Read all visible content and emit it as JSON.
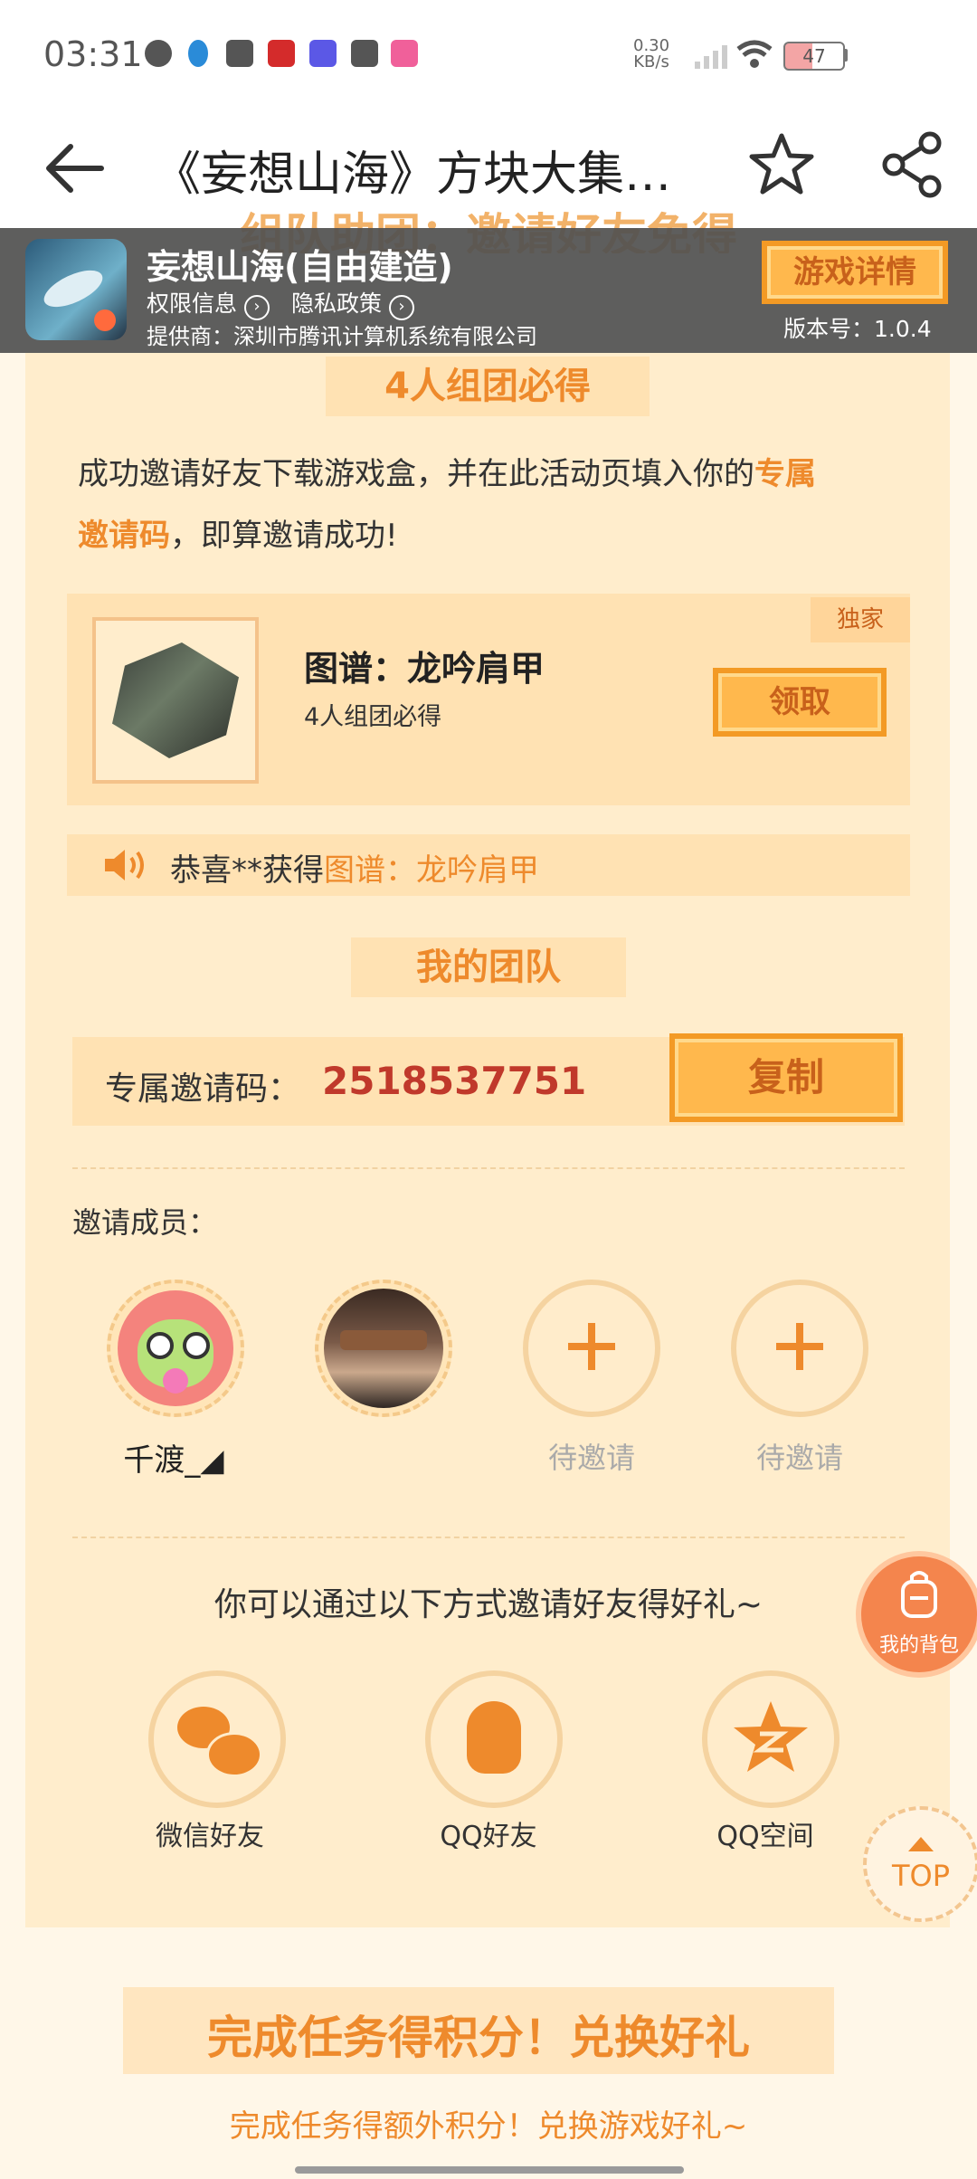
{
  "status_bar": {
    "time": "03:31",
    "net_speed_value": "0.30",
    "net_speed_unit": "KB/s",
    "battery": "47",
    "app_icons": [
      "play-icon",
      "qq-icon",
      "message-icon",
      "qidian-icon",
      "canva-icon",
      "video-icon",
      "app-icon"
    ]
  },
  "nav": {
    "title": "《妄想山海》方块大集…"
  },
  "game_bar": {
    "name": "妄想山海(自由建造)",
    "permission_label": "权限信息",
    "privacy_label": "隐私政策",
    "provider": "提供商：深圳市腾讯计算机系统有限公司",
    "detail_button": "游戏详情",
    "version": "版本号：1.0.4"
  },
  "invite": {
    "hidden_heading": "组队助团：邀请好友免得",
    "section_tag": "4人组团必得",
    "desc_part1": "成功邀请好友下载游戏盒，并在此活动页填入你的",
    "desc_highlight1": "专属",
    "desc_highlight2": "邀请码",
    "desc_part2": "，即算邀请成功!",
    "reward": {
      "badge": "独家",
      "title": "图谱：龙吟肩甲",
      "subtitle": "4人组团必得",
      "claim_button": "领取"
    },
    "ticker": {
      "prefix": "恭喜**获得",
      "item": "图谱：龙吟肩甲"
    },
    "team_tag": "我的团队",
    "code_label": "专属邀请码：",
    "code_value": "2518537751",
    "copy_button": "复制",
    "members_label": "邀请成员：",
    "members": [
      {
        "name": "千渡_◢",
        "avatar": "candy-avatar"
      },
      {
        "name": "",
        "avatar": "portrait-avatar"
      },
      {
        "name": "待邀请",
        "avatar": "plus-icon"
      },
      {
        "name": "待邀请",
        "avatar": "plus-icon"
      }
    ],
    "share_prompt": "你可以通过以下方式邀请好友得好礼~",
    "share": [
      {
        "label": "微信好友",
        "icon": "wechat-icon"
      },
      {
        "label": "QQ好友",
        "icon": "qq-icon"
      },
      {
        "label": "QQ空间",
        "icon": "qzone-icon"
      }
    ]
  },
  "floating": {
    "backpack_label": "我的背包",
    "top_label": "TOP"
  },
  "tasks": {
    "title": "完成任务得积分！兑换好礼",
    "subtitle": "完成任务得额外积分！兑换游戏好礼~"
  },
  "colors": {
    "accent": "#ee8a2c",
    "code_red": "#c0392b",
    "card_bg": "#ffedcc",
    "page_bg": "#fff7e8"
  }
}
